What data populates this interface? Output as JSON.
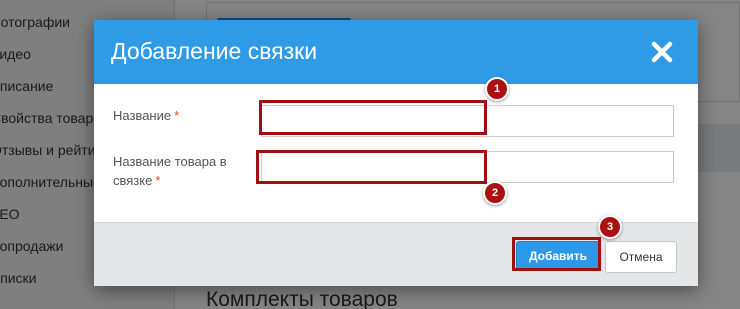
{
  "background": {
    "sidebar_items": [
      "Фотографии",
      "Видео",
      "Описание",
      "Свойства товара",
      "Отзывы и рейтинг",
      "Дополнительные",
      "SEO",
      "Допродажи",
      "Списки"
    ],
    "section_heading": "Комплекты товаров"
  },
  "modal": {
    "title": "Добавление связки",
    "close_icon": "close-icon",
    "fields": [
      {
        "label": "Название",
        "required_mark": "*",
        "value": ""
      },
      {
        "label_line1": "Название товара в",
        "label_line2": "связке",
        "required_mark": "*",
        "value": ""
      }
    ],
    "buttons": {
      "add": "Добавить",
      "cancel": "Отмена"
    }
  },
  "annotations": {
    "markers": [
      "1",
      "2",
      "3"
    ],
    "highlight_color": "#a01010"
  },
  "colors": {
    "header": "#2f9be6",
    "primary_button": "#2d97e8",
    "required": "#e8442e"
  }
}
